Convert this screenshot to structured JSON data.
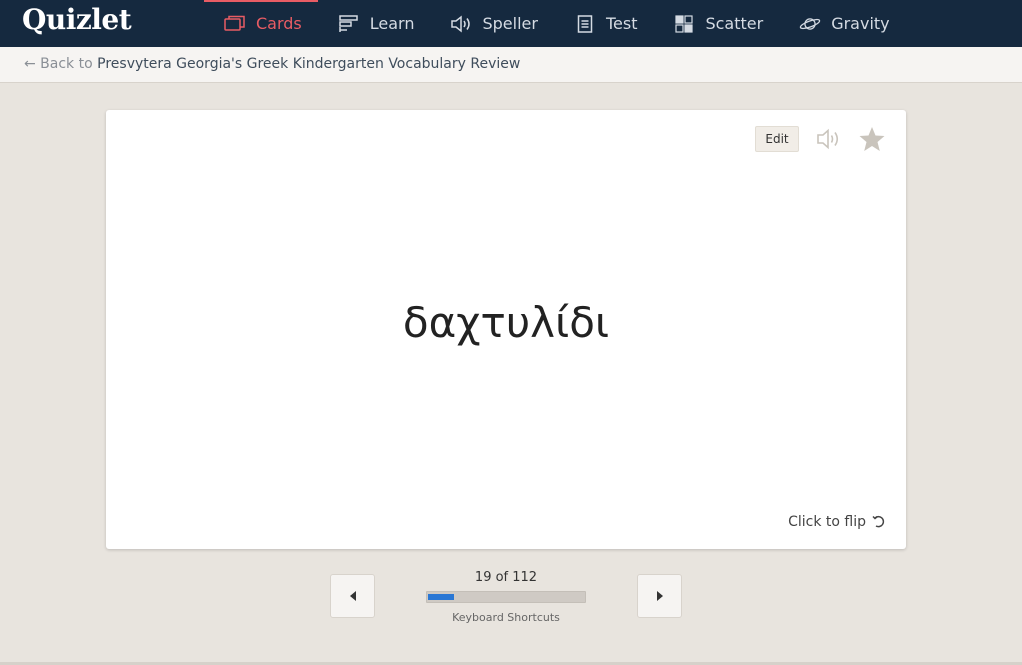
{
  "app": {
    "logo": "Quizlet"
  },
  "nav": {
    "items": [
      {
        "label": "Cards",
        "icon": "cards-icon",
        "active": true
      },
      {
        "label": "Learn",
        "icon": "learn-icon",
        "active": false
      },
      {
        "label": "Speller",
        "icon": "speaker-icon",
        "active": false
      },
      {
        "label": "Test",
        "icon": "test-icon",
        "active": false
      },
      {
        "label": "Scatter",
        "icon": "scatter-icon",
        "active": false
      },
      {
        "label": "Gravity",
        "icon": "planet-icon",
        "active": false
      }
    ]
  },
  "breadcrumb": {
    "back_label": "← Back to",
    "set_title": "Presvytera Georgia's Greek Kindergarten Vocabulary Review"
  },
  "card": {
    "edit_label": "Edit",
    "term": "δαχτυλίδι",
    "flip_label": "Click to flip"
  },
  "controls": {
    "counter": "19 of 112",
    "current": 19,
    "total": 112,
    "shortcuts_label": "Keyboard Shortcuts"
  },
  "colors": {
    "nav_bg": "#15293f",
    "active": "#e85c64",
    "progress": "#2a77d4",
    "page_bg": "#e8e4de"
  }
}
